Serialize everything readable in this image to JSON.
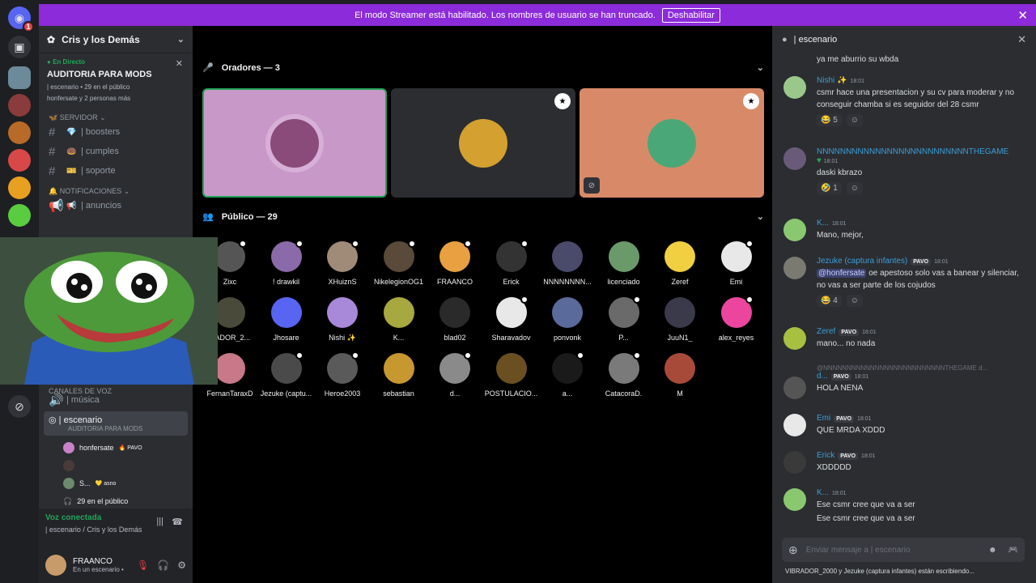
{
  "banner": {
    "text": "El modo Streamer está habilitado. Los nombres de usuario se han truncado.",
    "button": "Deshabilitar"
  },
  "rail": {
    "badge": "1"
  },
  "sidebar": {
    "server_name": "Cris y los Demás",
    "live": {
      "tag": "En Directo",
      "title": "AUDITORIA PARA MODS",
      "sub1": "| escenario • 29 en el público",
      "sub2": "honfersate y 2 personas más"
    },
    "cat_server": "SERVIDOR",
    "channels1": [
      {
        "emoji": "💎",
        "name": "| boosters"
      },
      {
        "emoji": "🍩",
        "name": "| cumples"
      },
      {
        "emoji": "🎫",
        "name": "| soporte"
      }
    ],
    "cat_notif": "NOTIFICACIONES",
    "channels2": [
      {
        "emoji": "📢",
        "name": "| anuncios"
      }
    ],
    "cat_voice": "CANALES DE VOZ",
    "voice_music": "| música",
    "stage": {
      "name": "| escenario",
      "sub": "AUDITORIA PARA MODS"
    },
    "members": [
      {
        "name": "honfersate",
        "tag": "PAVO"
      },
      {
        "name": ""
      },
      {
        "name": "S...",
        "tag": "asno"
      }
    ],
    "audience_count": "29 en el público",
    "voice": {
      "status": "Voz conectada",
      "where": "| escenario / Cris y los Demás"
    },
    "user": {
      "name": "FRAANCO",
      "status": "En un escenario •"
    }
  },
  "stage": {
    "speakers_title": "Oradores — 3",
    "audience_title": "Público — 29",
    "audience": [
      "Zixc",
      "! drawkil",
      "XHuiznS",
      "NikelegionOG1",
      "FRAANCO",
      "Erick",
      "NNNNNNNN...",
      "licenciado",
      "Zeref",
      "Emi",
      "RADOR_2...",
      "Jhosare",
      "Nishi ✨",
      "K...",
      "blad02",
      "Sharavadov",
      "ponvonk",
      "P...",
      "JuuN1_",
      "alex_reyes",
      "FernanTaraxD",
      "Jezuke (captu...",
      "Heroe2003",
      "sebastian",
      "d...",
      "POSTULACIO...",
      "a...",
      "CatacoraD.",
      "M"
    ]
  },
  "chat": {
    "title": "| escenario",
    "messages": [
      {
        "body": "ya me aburrio su wbda"
      },
      {
        "name": "Nishi ✨",
        "time": "18:01",
        "body": "csmr hace una presentacion y su cv para moderar y no conseguir chamba si es seguidor del 28 csmr",
        "reaction": "😂 5"
      },
      {
        "name": "NNNNNNNNNNNNNNNNNNNNNNNNNNTHEGAME",
        "time": "18:01",
        "body": "daski kbrazo",
        "reaction": "🤣 1"
      },
      {
        "name": "K...",
        "time": "18:01",
        "body": "Mano, mejor,"
      },
      {
        "name": "Jezuke (captura infantes)",
        "tag": "PAVO",
        "time": "18:01",
        "mention": "@honfersate",
        "body": "oe apestoso solo vas a banear y silenciar, no vas a ser parte de los cojudos",
        "reaction": "😂 4"
      },
      {
        "name": "Zeref",
        "tag": "PAVO",
        "time": "18:01",
        "body": "mano... no nada"
      },
      {
        "name": "d...",
        "tag": "PAVO",
        "time": "18:01",
        "reply": "@NNNNNNNNNNNNNNNNNNNNNNNNNNTHEGAME d...",
        "body": "HOLA NENA"
      },
      {
        "name": "Emi",
        "tag": "PAVO",
        "time": "18:01",
        "body": "QUE MRDA XDDD"
      },
      {
        "name": "Erick",
        "tag": "PAVO",
        "time": "18:01",
        "body": "XDDDDD"
      },
      {
        "name": "K...",
        "time": "18:01",
        "body": "Ese csmr cree que va a ser",
        "body2": "Ese csmr cree que va a ser"
      }
    ],
    "input_placeholder": "Enviar mensaje a  | escenario",
    "typing": "VIBRADOR_2000 y Jezuke (captura infantes) están escribiendo..."
  }
}
